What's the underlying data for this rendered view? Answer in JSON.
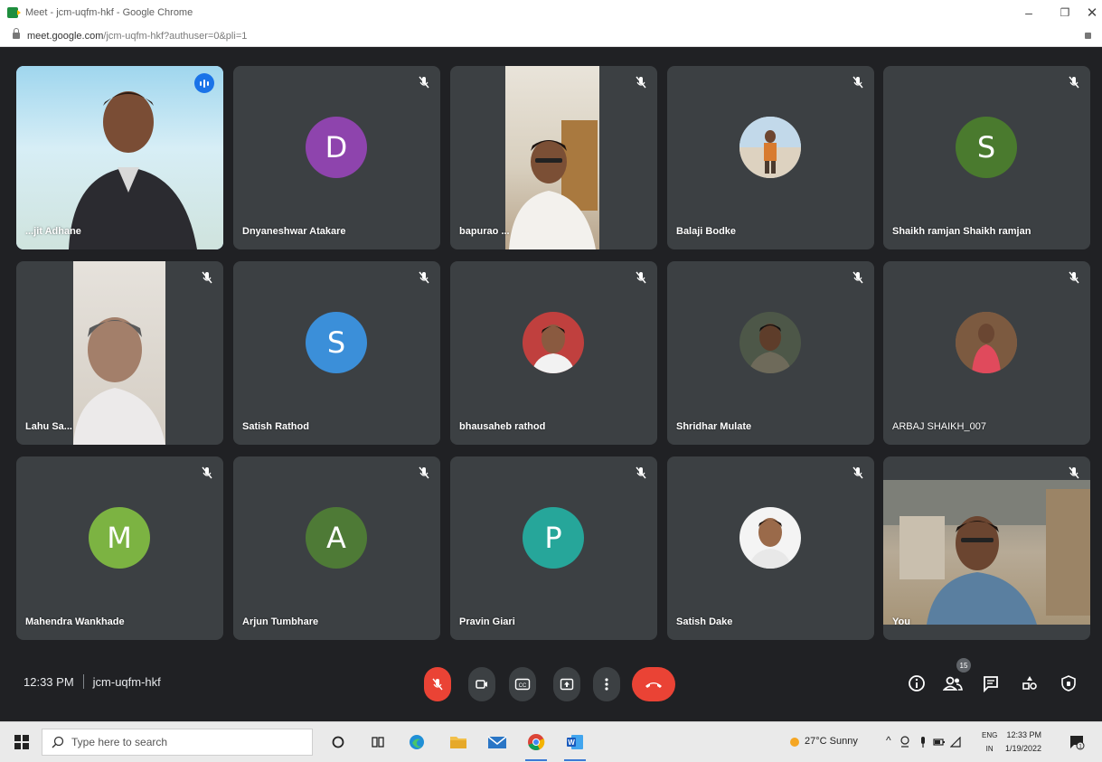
{
  "window": {
    "title": "Meet - jcm-uqfm-hkf - Google Chrome",
    "url_host": "meet.google.com",
    "url_path": "/jcm-uqfm-hkf?authuser=0&pli=1",
    "controls": {
      "minimize": "–",
      "maximize": "❐",
      "close": "✕"
    }
  },
  "meeting": {
    "time": "12:33 PM",
    "code": "jcm-uqfm-hkf",
    "participant_count": "15"
  },
  "participants": [
    {
      "name": "...jit Adhane",
      "type": "video",
      "speaking": true,
      "muted": false
    },
    {
      "name": "Dnyaneshwar Atakare",
      "type": "letter",
      "letter": "D",
      "color": "#8e44ad",
      "muted": true
    },
    {
      "name": "bapurao ...",
      "type": "video",
      "muted": true
    },
    {
      "name": "Balaji Bodke",
      "type": "photo",
      "muted": true
    },
    {
      "name": "Shaikh ramjan Shaikh ramjan",
      "type": "letter",
      "letter": "S",
      "color": "#4a7a2e",
      "muted": true
    },
    {
      "name": "Lahu Sa...",
      "type": "video",
      "muted": true
    },
    {
      "name": "Satish Rathod",
      "type": "letter",
      "letter": "S",
      "color": "#3b8fd9",
      "muted": true
    },
    {
      "name": "bhausaheb rathod",
      "type": "photo",
      "muted": true
    },
    {
      "name": "Shridhar Mulate",
      "type": "photo",
      "muted": true
    },
    {
      "name": "ARBAJ SHAIKH_007",
      "type": "photo",
      "muted": true
    },
    {
      "name": "Mahendra Wankhade",
      "type": "letter",
      "letter": "M",
      "color": "#7cb342",
      "muted": true
    },
    {
      "name": "Arjun Tumbhare",
      "type": "letter",
      "letter": "A",
      "color": "#4e7a36",
      "muted": true
    },
    {
      "name": "Pravin Giari",
      "type": "letter",
      "letter": "P",
      "color": "#26a69a",
      "muted": true
    },
    {
      "name": "Satish Dake",
      "type": "photo",
      "muted": true
    },
    {
      "name": "You",
      "type": "video",
      "muted": true
    }
  ],
  "controls": {
    "mic": "mic-off-icon",
    "camera": "camera-icon",
    "captions_label": "CC",
    "present": "present-icon",
    "more": "more-vert-icon",
    "hangup": "call-end-icon",
    "info": "info-icon",
    "people": "people-icon",
    "chat": "chat-icon",
    "activities": "activities-icon",
    "host": "host-controls-icon"
  },
  "taskbar": {
    "search_placeholder": "Type here to search",
    "weather": "27°C  Sunny",
    "lang_top": "ENG",
    "lang_bottom": "IN",
    "clock_time": "12:33 PM",
    "clock_date": "1/19/2022",
    "notifications": "1"
  },
  "colors": {
    "stage_bg": "#202124",
    "tile_bg": "#3c4043",
    "speaking_outline": "#8ab4f8",
    "hangup_red": "#ea4335"
  }
}
